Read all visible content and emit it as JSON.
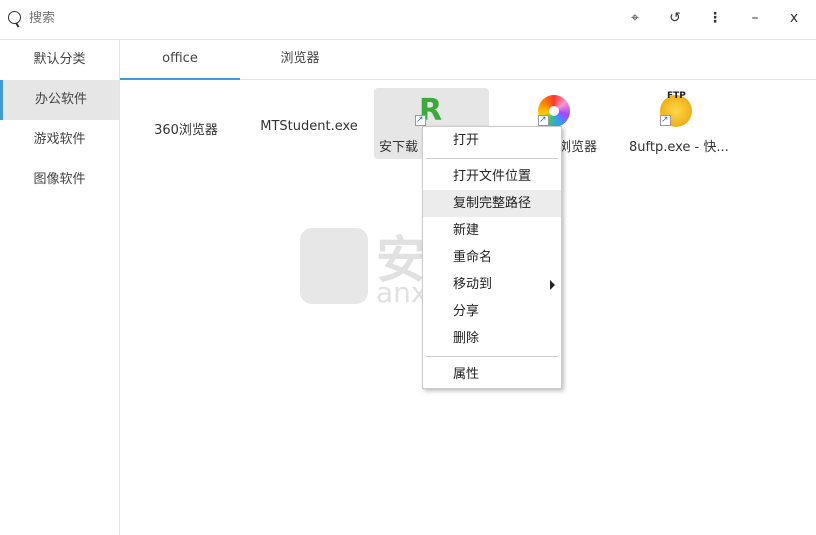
{
  "search": {
    "placeholder": "搜索"
  },
  "toolbar": {
    "pin": "pin-icon",
    "history": "history-icon",
    "more": "more-icon",
    "minimize": "–",
    "close": "x"
  },
  "sidebar": {
    "items": [
      {
        "label": "默认分类"
      },
      {
        "label": "办公软件"
      },
      {
        "label": "游戏软件"
      },
      {
        "label": "图像软件"
      }
    ],
    "active": 1
  },
  "tabs": [
    {
      "label": "office"
    },
    {
      "label": "浏览器"
    }
  ],
  "items": [
    {
      "label": "360浏览器"
    },
    {
      "label": "MTStudent.exe"
    },
    {
      "label": "安下载"
    },
    {
      "label": "浏览器"
    },
    {
      "label": "8uftp.exe - 快..."
    }
  ],
  "context_menu": {
    "items": [
      "打开",
      "打开文件位置",
      "复制完整路径",
      "新建",
      "重命名",
      "移动到",
      "分享",
      "删除",
      "属性"
    ],
    "highlighted": "复制完整路径"
  },
  "watermark": {
    "text": "安下载",
    "sub": "anxz.com"
  },
  "colors": {
    "accent": "#3c9bd6"
  }
}
